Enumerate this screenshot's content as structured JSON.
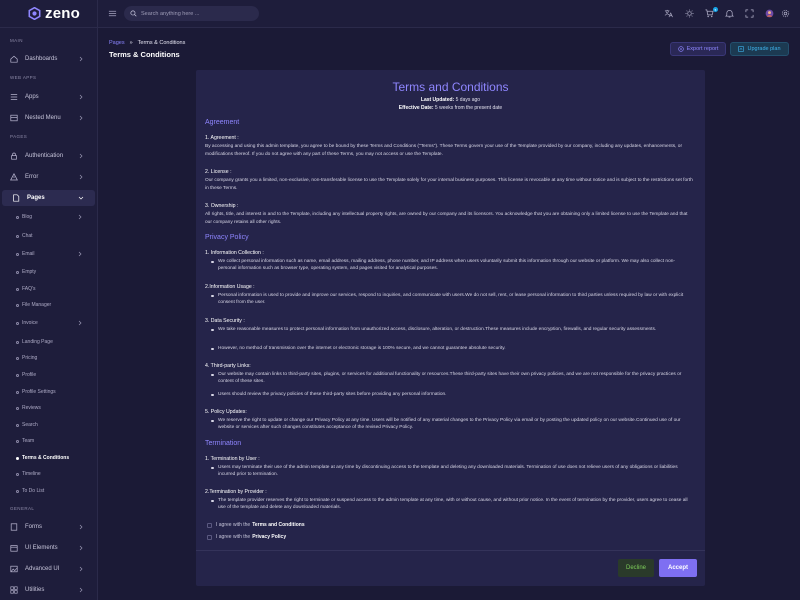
{
  "app": {
    "logo_text": "zeno"
  },
  "header": {
    "search_placeholder": "Search anything here ...",
    "cart_badge": "5"
  },
  "sidebar": {
    "sections": {
      "main": "MAIN",
      "web_apps": "WEB APPS",
      "pages": "PAGES",
      "general": "GENERAL"
    },
    "items": {
      "dashboards": "Dashboards",
      "apps": "Apps",
      "nested_menu": "Nested Menu",
      "authentication": "Authentication",
      "error": "Error",
      "pages": "Pages",
      "forms": "Forms",
      "ui_elements": "UI Elements",
      "advanced_ui": "Advanced UI",
      "utilities": "Utilities"
    },
    "sub_items": [
      "Blog",
      "Chat",
      "Email",
      "Empty",
      "FAQ's",
      "File Manager",
      "Invoice",
      "Landing Page",
      "Pricing",
      "Profile",
      "Profile Settings",
      "Reviews",
      "Search",
      "Team",
      "Terms & Conditions",
      "Timeline",
      "To Do List"
    ]
  },
  "breadcrumb": {
    "root": "Pages",
    "sep": "»",
    "current": "Terms & Conditions"
  },
  "page_title": "Terms & Conditions",
  "actions": {
    "export": "Export report",
    "upgrade": "Upgrade plan"
  },
  "card": {
    "title": "Terms and Conditions",
    "last_updated_label": "Last Updated:",
    "last_updated_value": "5 days ago",
    "effective_label": "Effective Date:",
    "effective_value": "5 weeks from the present date",
    "agreement": {
      "heading": "Agreement",
      "s1_title": "1. Agreement :",
      "s1_text": "By accessing and using this admin template, you agree to be bound by these Terms and Conditions (\"Terms\"). These Terms govern your use of the Template provided by our company, including any updates, enhancements, or modifications thereof. If you do not agree with any part of these Terms, you may not access or use the Template.",
      "s2_title": "2. License :",
      "s2_text": "Our company grants you a limited, non-exclusive, non-transferable license to use the Template solely for your internal business purposes. This license is revocable at any time without notice and is subject to the restrictions set forth in these Terms.",
      "s3_title": "3. Ownership :",
      "s3_text": "All rights, title, and interest in and to the Template, including any intellectual property rights, are owned by our company and its licensors. You acknowledge that you are obtaining only a limited license to use the Template and that our company retains all other rights."
    },
    "privacy": {
      "heading": "Privacy Policy",
      "p1_title": "1. Information Collection :",
      "p1_b1": "We collect personal information such as name, email address, mailing address, phone number, and IP address when users voluntarily submit this information through our website or platform. We may also collect non-personal information such as browser type, operating system, and pages visited for analytical purposes.",
      "p2_title": "2.Information Usage :",
      "p2_b1": "Personal information is used to provide and improve our services, respond to inquiries, and communicate with users.We do not sell, rent, or lease personal information to third parties unless required by law or with explicit consent from the user.",
      "p3_title": "3. Data Security :",
      "p3_b1": "We take reasonable measures to protect personal information from unauthorized access, disclosure, alteration, or destruction.These measures include encryption, firewalls, and regular security assessments.",
      "p3_b2": "However, no method of transmission over the internet or electronic storage is 100% secure, and we cannot guarantee absolute security.",
      "p4_title": "4. Third-party Links:",
      "p4_b1": "Our website may contain links to third-party sites, plugins, or services for additional functionality or resources.These third-party sites have their own privacy policies, and we are not responsible for the privacy practices or content of these sites.",
      "p4_b2": "Users should review the privacy policies of these third-party sites before providing any personal information.",
      "p5_title": "5. Policy Updates:",
      "p5_b1": "We reserve the right to update or change our Privacy Policy at any time. Users will be notified of any material changes to the Privacy Policy via email or by posting the updated policy on our website.Continued use of our website or services after such changes constitutes acceptance of the revised Privacy Policy."
    },
    "termination": {
      "heading": "Termination",
      "t1_title": "1. Termination by User :",
      "t1_b1": "Users may terminate their use of the admin template at any time by discontinuing access to the template and deleting any downloaded materials. Termination of use does not relieve users of any obligations or liabilities incurred prior to termination.",
      "t2_title": "2.Termination by Provider :",
      "t2_b1": "The template provider reserves the right to terminate or suspend access to the admin template at any time, with or without cause, and without prior notice. In the event of termination by the provider, users agree to cease all use of the template and delete any downloaded materials."
    },
    "agree_prefix": "I agree with the",
    "agree_terms": "Terms and Conditions",
    "agree_privacy": "Privacy Policy",
    "decline": "Decline",
    "accept": "Accept"
  }
}
